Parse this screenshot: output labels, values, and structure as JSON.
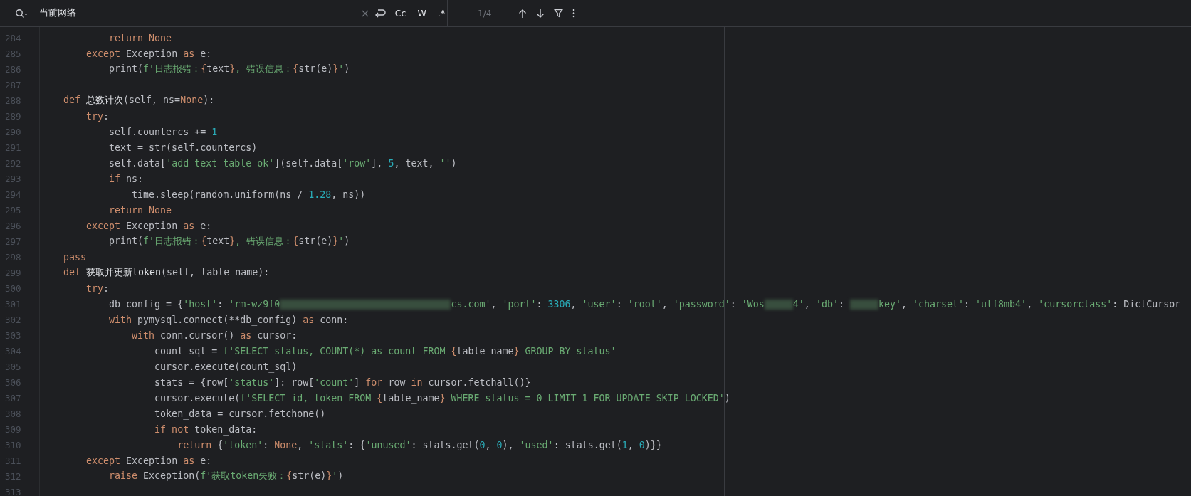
{
  "search": {
    "value": "当前网络",
    "options": [
      "Cc",
      "W",
      ".*"
    ],
    "match_count": "1/4"
  },
  "lines": [
    {
      "number": "284",
      "tokens": [
        {
          "kind": "kw",
          "text": "            return None"
        }
      ]
    },
    {
      "number": "285",
      "tokens": [
        {
          "kind": "kw",
          "text": "        except"
        },
        {
          "kind": "plain",
          "text": " Exception "
        },
        {
          "kind": "kw",
          "text": "as"
        },
        {
          "kind": "plain",
          "text": " e:"
        }
      ]
    },
    {
      "number": "286",
      "tokens": [
        {
          "kind": "plain",
          "text": "            print("
        },
        {
          "kind": "str",
          "text": "f'日志报错："
        },
        {
          "kind": "brace",
          "text": "{"
        },
        {
          "kind": "plain",
          "text": "text"
        },
        {
          "kind": "brace",
          "text": "}"
        },
        {
          "kind": "str",
          "text": ", 错误信息："
        },
        {
          "kind": "brace",
          "text": "{"
        },
        {
          "kind": "plain",
          "text": "str(e)"
        },
        {
          "kind": "brace",
          "text": "}"
        },
        {
          "kind": "str",
          "text": "'"
        },
        {
          "kind": "plain",
          "text": ")"
        }
      ]
    },
    {
      "number": "287"
    },
    {
      "number": "288",
      "tokens": [
        {
          "kind": "kw",
          "text": "    def"
        },
        {
          "kind": "name",
          "text": " 总数计次"
        },
        {
          "kind": "plain",
          "text": "(self, ns="
        },
        {
          "kind": "kw",
          "text": "None"
        },
        {
          "kind": "plain",
          "text": "):"
        }
      ]
    },
    {
      "number": "289",
      "tokens": [
        {
          "kind": "kw",
          "text": "        try"
        },
        {
          "kind": "plain",
          "text": ":"
        }
      ]
    },
    {
      "number": "290",
      "tokens": [
        {
          "kind": "plain",
          "text": "            self.countercs += "
        },
        {
          "kind": "num",
          "text": "1"
        }
      ]
    },
    {
      "number": "291",
      "tokens": [
        {
          "kind": "plain",
          "text": "            text = str(self.countercs)"
        }
      ]
    },
    {
      "number": "292",
      "tokens": [
        {
          "kind": "plain",
          "text": "            self.data["
        },
        {
          "kind": "str",
          "text": "'add_text_table_ok'"
        },
        {
          "kind": "plain",
          "text": "](self.data["
        },
        {
          "kind": "str",
          "text": "'row'"
        },
        {
          "kind": "plain",
          "text": "], "
        },
        {
          "kind": "num",
          "text": "5"
        },
        {
          "kind": "plain",
          "text": ", text, "
        },
        {
          "kind": "str",
          "text": "''"
        },
        {
          "kind": "plain",
          "text": ")"
        }
      ]
    },
    {
      "number": "293",
      "tokens": [
        {
          "kind": "kw",
          "text": "            if"
        },
        {
          "kind": "plain",
          "text": " ns:"
        }
      ]
    },
    {
      "number": "294",
      "tokens": [
        {
          "kind": "plain",
          "text": "                time.sleep(random.uniform(ns / "
        },
        {
          "kind": "num",
          "text": "1.28"
        },
        {
          "kind": "plain",
          "text": ", ns))"
        }
      ]
    },
    {
      "number": "295",
      "tokens": [
        {
          "kind": "kw",
          "text": "            return None"
        }
      ]
    },
    {
      "number": "296",
      "tokens": [
        {
          "kind": "kw",
          "text": "        except"
        },
        {
          "kind": "plain",
          "text": " Exception "
        },
        {
          "kind": "kw",
          "text": "as"
        },
        {
          "kind": "plain",
          "text": " e:"
        }
      ]
    },
    {
      "number": "297",
      "tokens": [
        {
          "kind": "plain",
          "text": "            print("
        },
        {
          "kind": "str",
          "text": "f'日志报错："
        },
        {
          "kind": "brace",
          "text": "{"
        },
        {
          "kind": "plain",
          "text": "text"
        },
        {
          "kind": "brace",
          "text": "}"
        },
        {
          "kind": "str",
          "text": ", 错误信息："
        },
        {
          "kind": "brace",
          "text": "{"
        },
        {
          "kind": "plain",
          "text": "str(e)"
        },
        {
          "kind": "brace",
          "text": "}"
        },
        {
          "kind": "str",
          "text": "'"
        },
        {
          "kind": "plain",
          "text": ")"
        }
      ]
    },
    {
      "number": "298",
      "tokens": [
        {
          "kind": "kw",
          "text": "    pass"
        }
      ]
    },
    {
      "number": "299",
      "tokens": [
        {
          "kind": "kw",
          "text": "    def"
        },
        {
          "kind": "name",
          "text": " 获取并更新token"
        },
        {
          "kind": "plain",
          "text": "(self, table_name):"
        }
      ]
    },
    {
      "number": "300",
      "tokens": [
        {
          "kind": "kw",
          "text": "        try"
        },
        {
          "kind": "plain",
          "text": ":"
        }
      ]
    },
    {
      "number": "301",
      "tokens": [
        {
          "kind": "plain",
          "text": "            db_config = {"
        },
        {
          "kind": "str",
          "text": "'host'"
        },
        {
          "kind": "plain",
          "text": ": "
        },
        {
          "kind": "str",
          "text": "'rm-wz9f0"
        },
        {
          "kind": "redacted_long"
        },
        {
          "kind": "str",
          "text": "cs.com'"
        },
        {
          "kind": "plain",
          "text": ", "
        },
        {
          "kind": "str",
          "text": "'port'"
        },
        {
          "kind": "plain",
          "text": ": "
        },
        {
          "kind": "num",
          "text": "3306"
        },
        {
          "kind": "plain",
          "text": ", "
        },
        {
          "kind": "str",
          "text": "'user'"
        },
        {
          "kind": "plain",
          "text": ": "
        },
        {
          "kind": "str",
          "text": "'root'"
        },
        {
          "kind": "plain",
          "text": ", "
        },
        {
          "kind": "str",
          "text": "'password'"
        },
        {
          "kind": "plain",
          "text": ": "
        },
        {
          "kind": "str",
          "text": "'Wos"
        },
        {
          "kind": "redacted_short"
        },
        {
          "kind": "str",
          "text": "4'"
        },
        {
          "kind": "plain",
          "text": ", "
        },
        {
          "kind": "str",
          "text": "'db'"
        },
        {
          "kind": "plain",
          "text": ": "
        },
        {
          "kind": "redacted_short"
        },
        {
          "kind": "str",
          "text": "key'"
        },
        {
          "kind": "plain",
          "text": ", "
        },
        {
          "kind": "str",
          "text": "'charset'"
        },
        {
          "kind": "plain",
          "text": ": "
        },
        {
          "kind": "str",
          "text": "'utf8mb4'"
        },
        {
          "kind": "plain",
          "text": ", "
        },
        {
          "kind": "str",
          "text": "'cursorclass'"
        },
        {
          "kind": "plain",
          "text": ": DictCursor"
        }
      ]
    },
    {
      "number": "302",
      "tokens": [
        {
          "kind": "kw",
          "text": "            with"
        },
        {
          "kind": "plain",
          "text": " pymysql.connect(**db_config) "
        },
        {
          "kind": "kw",
          "text": "as"
        },
        {
          "kind": "plain",
          "text": " conn:"
        }
      ]
    },
    {
      "number": "303",
      "tokens": [
        {
          "kind": "kw",
          "text": "                with"
        },
        {
          "kind": "plain",
          "text": " conn.cursor() "
        },
        {
          "kind": "kw",
          "text": "as"
        },
        {
          "kind": "plain",
          "text": " cursor:"
        }
      ]
    },
    {
      "number": "304",
      "tokens": [
        {
          "kind": "plain",
          "text": "                    count_sql = "
        },
        {
          "kind": "str",
          "text": "f'SELECT status, COUNT(*) as count FROM "
        },
        {
          "kind": "brace",
          "text": "{"
        },
        {
          "kind": "plain",
          "text": "table_name"
        },
        {
          "kind": "brace",
          "text": "}"
        },
        {
          "kind": "str",
          "text": " GROUP BY status'"
        }
      ]
    },
    {
      "number": "305",
      "tokens": [
        {
          "kind": "plain",
          "text": "                    cursor.execute(count_sql)"
        }
      ]
    },
    {
      "number": "306",
      "tokens": [
        {
          "kind": "plain",
          "text": "                    stats = {row["
        },
        {
          "kind": "str",
          "text": "'status'"
        },
        {
          "kind": "plain",
          "text": "]: row["
        },
        {
          "kind": "str",
          "text": "'count'"
        },
        {
          "kind": "plain",
          "text": "] "
        },
        {
          "kind": "kw",
          "text": "for"
        },
        {
          "kind": "plain",
          "text": " row "
        },
        {
          "kind": "kw",
          "text": "in"
        },
        {
          "kind": "plain",
          "text": " cursor.fetchall()}"
        }
      ]
    },
    {
      "number": "307",
      "tokens": [
        {
          "kind": "plain",
          "text": "                    cursor.execute("
        },
        {
          "kind": "str",
          "text": "f'SELECT id, token FROM "
        },
        {
          "kind": "brace",
          "text": "{"
        },
        {
          "kind": "plain",
          "text": "table_name"
        },
        {
          "kind": "brace",
          "text": "}"
        },
        {
          "kind": "str",
          "text": " WHERE status = 0 LIMIT 1 FOR UPDATE SKIP LOCKED'"
        },
        {
          "kind": "plain",
          "text": ")"
        }
      ]
    },
    {
      "number": "308",
      "tokens": [
        {
          "kind": "plain",
          "text": "                    token_data = cursor.fetchone()"
        }
      ]
    },
    {
      "number": "309",
      "tokens": [
        {
          "kind": "kw",
          "text": "                    if not"
        },
        {
          "kind": "plain",
          "text": " token_data:"
        }
      ]
    },
    {
      "number": "310",
      "tokens": [
        {
          "kind": "kw",
          "text": "                        return"
        },
        {
          "kind": "plain",
          "text": " {"
        },
        {
          "kind": "str",
          "text": "'token'"
        },
        {
          "kind": "plain",
          "text": ": "
        },
        {
          "kind": "kw",
          "text": "None"
        },
        {
          "kind": "plain",
          "text": ", "
        },
        {
          "kind": "str",
          "text": "'stats'"
        },
        {
          "kind": "plain",
          "text": ": {"
        },
        {
          "kind": "str",
          "text": "'unused'"
        },
        {
          "kind": "plain",
          "text": ": stats.get("
        },
        {
          "kind": "num",
          "text": "0"
        },
        {
          "kind": "plain",
          "text": ", "
        },
        {
          "kind": "num",
          "text": "0"
        },
        {
          "kind": "plain",
          "text": "), "
        },
        {
          "kind": "str",
          "text": "'used'"
        },
        {
          "kind": "plain",
          "text": ": stats.get("
        },
        {
          "kind": "num",
          "text": "1"
        },
        {
          "kind": "plain",
          "text": ", "
        },
        {
          "kind": "num",
          "text": "0"
        },
        {
          "kind": "plain",
          "text": ")}}"
        }
      ]
    },
    {
      "number": "311",
      "tokens": [
        {
          "kind": "kw",
          "text": "        except"
        },
        {
          "kind": "plain",
          "text": " Exception "
        },
        {
          "kind": "kw",
          "text": "as"
        },
        {
          "kind": "plain",
          "text": " e:"
        }
      ]
    },
    {
      "number": "312",
      "tokens": [
        {
          "kind": "kw",
          "text": "            raise"
        },
        {
          "kind": "plain",
          "text": " Exception("
        },
        {
          "kind": "str",
          "text": "f'获取token失败："
        },
        {
          "kind": "brace",
          "text": "{"
        },
        {
          "kind": "plain",
          "text": "str(e)"
        },
        {
          "kind": "brace",
          "text": "}"
        },
        {
          "kind": "str",
          "text": "'"
        },
        {
          "kind": "plain",
          "text": ")"
        }
      ]
    },
    {
      "number": "313"
    }
  ]
}
